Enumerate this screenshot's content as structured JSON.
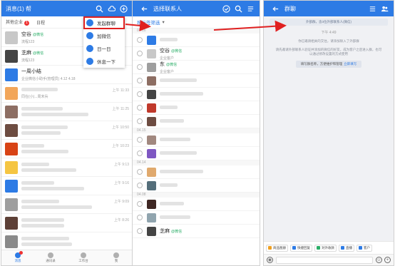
{
  "panel1": {
    "title": "消息(1) 帮",
    "subtabs": [
      "其他企业",
      "日程"
    ],
    "subtab_badge": "1",
    "menu": [
      "发起群聊",
      "加微信",
      "日一日",
      "休息一下"
    ],
    "chats": [
      {
        "name": "空谷",
        "tag": "@微信",
        "sub": "流程123",
        "time": "",
        "color": "#c8c8c8"
      },
      {
        "name": "芝麻",
        "tag": "@微信",
        "sub": "流程123",
        "time": "",
        "color": "#444444"
      },
      {
        "name": "一周小结",
        "tag": "",
        "sub": "企业微信小助手(管理员) 4.12 4.18",
        "time": "",
        "color": "#2d7be5"
      },
      {
        "name": "",
        "tag": "",
        "sub": "同在(小)...周末兵",
        "time": "上午 11:33",
        "color": "#f2a65a"
      },
      {
        "name": "",
        "tag": "",
        "sub": "",
        "time": "上午 11:25",
        "color": "#8d6e63"
      },
      {
        "name": "",
        "tag": "",
        "sub": "",
        "time": "上午 10:50",
        "color": "#6d4c41"
      },
      {
        "name": "",
        "tag": "",
        "sub": "",
        "time": "上午 10:23",
        "color": "#d84315"
      },
      {
        "name": "",
        "tag": "",
        "sub": "",
        "time": "上午 9:13",
        "color": "#f5c542"
      },
      {
        "name": "",
        "tag": "",
        "sub": "",
        "time": "上午 9:16",
        "color": "#2d7be5"
      },
      {
        "name": "",
        "tag": "",
        "sub": "",
        "time": "上午 9:09",
        "color": "#9e9e9e"
      },
      {
        "name": "",
        "tag": "",
        "sub": "",
        "time": "上午 8:26",
        "color": "#5d4037"
      },
      {
        "name": "",
        "tag": "",
        "sub": "",
        "time": "",
        "color": "#8a8a8a"
      }
    ],
    "nav": [
      "消息",
      "通讯录",
      "工作台",
      "我"
    ],
    "nav_badge": "3"
  },
  "panel2": {
    "title": "选择联系人",
    "filter": "按标签筛选",
    "sections": [
      "04.16",
      "04.15",
      "04.14",
      "04.08"
    ],
    "contacts": [
      {
        "name": "",
        "sub": "",
        "color": "#2d7be5",
        "section": 0
      },
      {
        "name": "空谷",
        "tag": "@微信",
        "sub": "企业客户",
        "color": "#c8c8c8",
        "section": -1
      },
      {
        "name": "东",
        "tag": "@微信",
        "sub": "企业客户",
        "color": "#9e9e9e",
        "section": -1
      },
      {
        "name": "",
        "sub": "",
        "color": "#8d6e63",
        "section": -1
      },
      {
        "name": "",
        "sub": "",
        "color": "#444444",
        "section": -1
      },
      {
        "name": "",
        "sub": "",
        "color": "#c0392b",
        "section": -1
      },
      {
        "name": "",
        "sub": "",
        "color": "#6d4c41",
        "section": -1
      },
      {
        "name": "",
        "sub": "",
        "color": "#a1887f",
        "section": 1
      },
      {
        "name": "",
        "sub": "",
        "color": "#7e57c2",
        "section": -1
      },
      {
        "name": "",
        "sub": "",
        "color": "#e0a96d",
        "section": 2
      },
      {
        "name": "",
        "sub": "",
        "color": "#546e7a",
        "section": -1
      },
      {
        "name": "",
        "sub": "",
        "color": "#3e2723",
        "section": 3
      },
      {
        "name": "",
        "sub": "",
        "color": "#90a4ae",
        "section": -1
      },
      {
        "name": "芝麻",
        "tag": "@微信",
        "sub": "",
        "color": "#444444",
        "section": -1
      }
    ]
  },
  "panel3": {
    "title": "群聊",
    "notice": "外部群，含3位外部联系人(微信)",
    "time": "下午 4:49",
    "sys1": "你已邀请相关的交往，请添加除入了外部群",
    "sys2": "请先邀请外部联系人验证并添加的微信的好友，成为客户之后进入群，也可以通过修改设置的方式使用",
    "btn": "填写群名称，方便维护和管理",
    "btn_link": "立即填写",
    "quick": [
      {
        "label": "商品图册",
        "color": "#f0a020"
      },
      {
        "label": "快捷回复",
        "color": "#2d7be5"
      },
      {
        "label": "对外收款",
        "color": "#2aae67"
      },
      {
        "label": "直播",
        "color": "#2d7be5"
      },
      {
        "label": "客户",
        "color": "#2d7be5"
      }
    ]
  },
  "colors": {
    "brand": "#2d7be5",
    "highlight": "#e02020",
    "wechat": "#2aae67"
  }
}
